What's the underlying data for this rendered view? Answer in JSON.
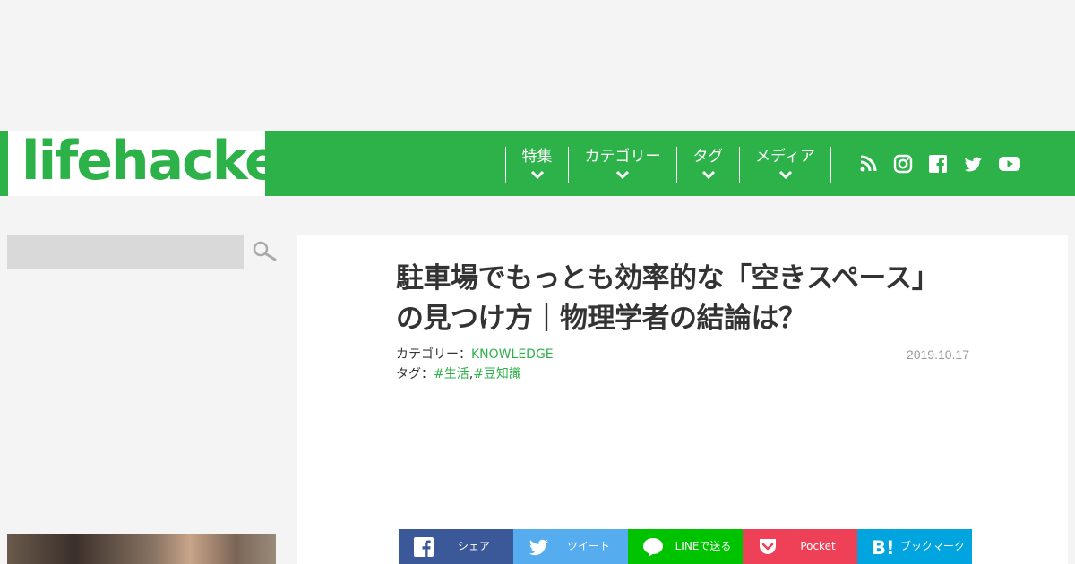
{
  "brand": {
    "logo_text": "lifehacker",
    "color": "#2db24a"
  },
  "nav": {
    "items": [
      {
        "label": "特集"
      },
      {
        "label": "カテゴリー"
      },
      {
        "label": "タグ"
      },
      {
        "label": "メディア"
      }
    ],
    "social_icons": [
      "rss-icon",
      "instagram-icon",
      "facebook-icon",
      "twitter-icon",
      "youtube-icon"
    ]
  },
  "sidebar": {
    "search": {
      "value": "",
      "placeholder": ""
    }
  },
  "article": {
    "title_line1": "駐車場でもっとも効率的な「空きスペース」",
    "title_line2": "の見つけ方｜物理学者の結論は？",
    "category_label": "カテゴリー：",
    "category_value": "KNOWLEDGE",
    "tags_label": "タグ：",
    "tags": [
      "#生活",
      "#豆知識"
    ],
    "tag_sep": ",",
    "date": "2019.10.17"
  },
  "share": [
    {
      "label": "シェア",
      "icon": "facebook-icon",
      "color": "#3b5998"
    },
    {
      "label": "ツイート",
      "icon": "twitter-icon",
      "color": "#55acee"
    },
    {
      "label": "LINEで送る",
      "icon": "line-icon",
      "color": "#00c300"
    },
    {
      "label": "Pocket",
      "icon": "pocket-icon",
      "color": "#ee4056"
    },
    {
      "label": "ブックマーク",
      "icon": "hatena-bookmark-icon",
      "color": "#00a4de"
    }
  ]
}
